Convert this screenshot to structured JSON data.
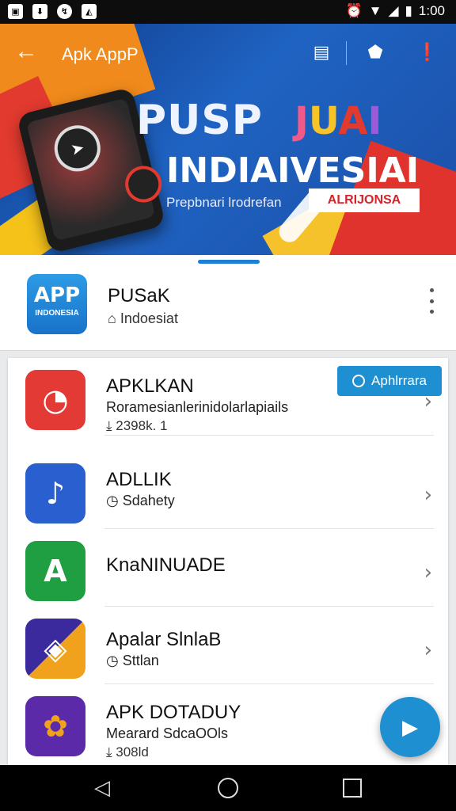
{
  "status_bar": {
    "left_icons": [
      "gallery-icon",
      "download-icon",
      "messenger-icon",
      "photo-icon"
    ],
    "time": "1:00"
  },
  "app_bar": {
    "title": "Apk AppP",
    "actions": [
      "sim-card-icon",
      "shield-icon",
      "alert-icon"
    ]
  },
  "hero": {
    "title": "PUSP",
    "title_colored": [
      "J",
      "U",
      "A",
      "I"
    ],
    "subtitle_big": "INDIAIVESIAI",
    "subtitle": "Prepbnari lrodrefan",
    "badge": "ALRIJONSA"
  },
  "header": {
    "logo_big": "APP",
    "logo_small": "INDONESIA",
    "title": "PUSaK",
    "subtitle": "Indoesiat",
    "subtitle_icon": "tag-icon",
    "menu_icon": "more-vert-icon"
  },
  "list": {
    "badge_label": "Aphlrrara",
    "items": [
      {
        "name": "APKLKAN",
        "desc": "Roramesianlerinidolarlapiails",
        "meta": "2398k.  1",
        "meta_icon": "download-count-icon",
        "icon_color": "#e43a36",
        "icon_glyph": "◔"
      },
      {
        "name": "ADLLIK",
        "desc": "",
        "meta": "Sdahety",
        "meta_icon": "clock-icon",
        "icon_color": "#2a5fcf",
        "icon_glyph": "♪"
      },
      {
        "name": "KnaNINUADE",
        "desc": "",
        "meta": "",
        "meta_icon": "",
        "icon_color": "#1f9e42",
        "icon_glyph": "A"
      },
      {
        "name": "Apalar SlnlaB",
        "desc": "",
        "meta": "Sttlan",
        "meta_icon": "clock-icon",
        "icon_color": "#4a2f9e",
        "icon_glyph": "◈"
      },
      {
        "name": "APK DOTADUY",
        "desc": "Mearard SdcaOOls",
        "meta": "308ld",
        "meta_icon": "download-count-icon",
        "icon_color": "#5b2aa8",
        "icon_glyph": "✿"
      }
    ]
  },
  "fab": {
    "icon": "play-icon"
  },
  "nav_bar": {
    "buttons": [
      "back-icon",
      "home-icon",
      "recents-icon"
    ]
  }
}
